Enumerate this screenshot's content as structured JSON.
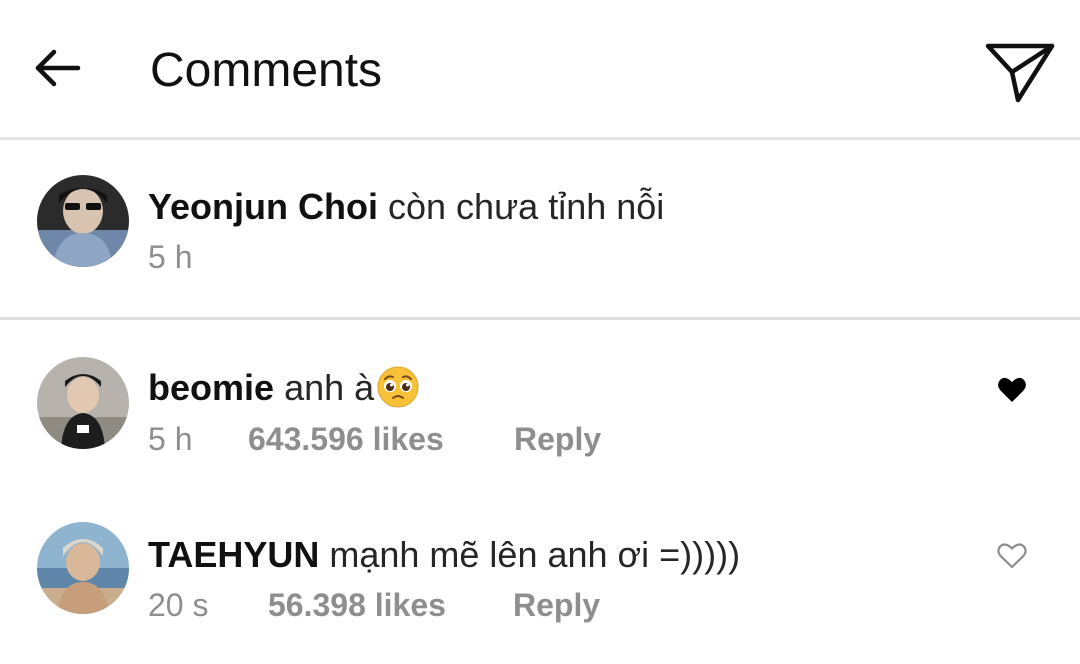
{
  "header": {
    "title": "Comments",
    "back_icon": "arrow-left-icon",
    "send_icon": "paper-plane-icon"
  },
  "caption": {
    "username": "Yeonjun Choi",
    "text": "còn chưa tỉnh nỗi",
    "time": "5 h"
  },
  "comments": [
    {
      "username": "beomie",
      "text": "anh à",
      "emoji": "pleading-face-emoji",
      "time": "5 h",
      "likes": "643.596 likes",
      "reply": "Reply",
      "liked": true
    },
    {
      "username": "TAEHYUN",
      "text": "mạnh mẽ lên anh ơi =)))))",
      "time": "20 s",
      "likes": "56.398 likes",
      "reply": "Reply",
      "liked": false
    }
  ],
  "colors": {
    "text": "#262626",
    "secondary": "#8e8e8e",
    "divider": "#e5e5e5",
    "heart_filled": "#000000"
  }
}
